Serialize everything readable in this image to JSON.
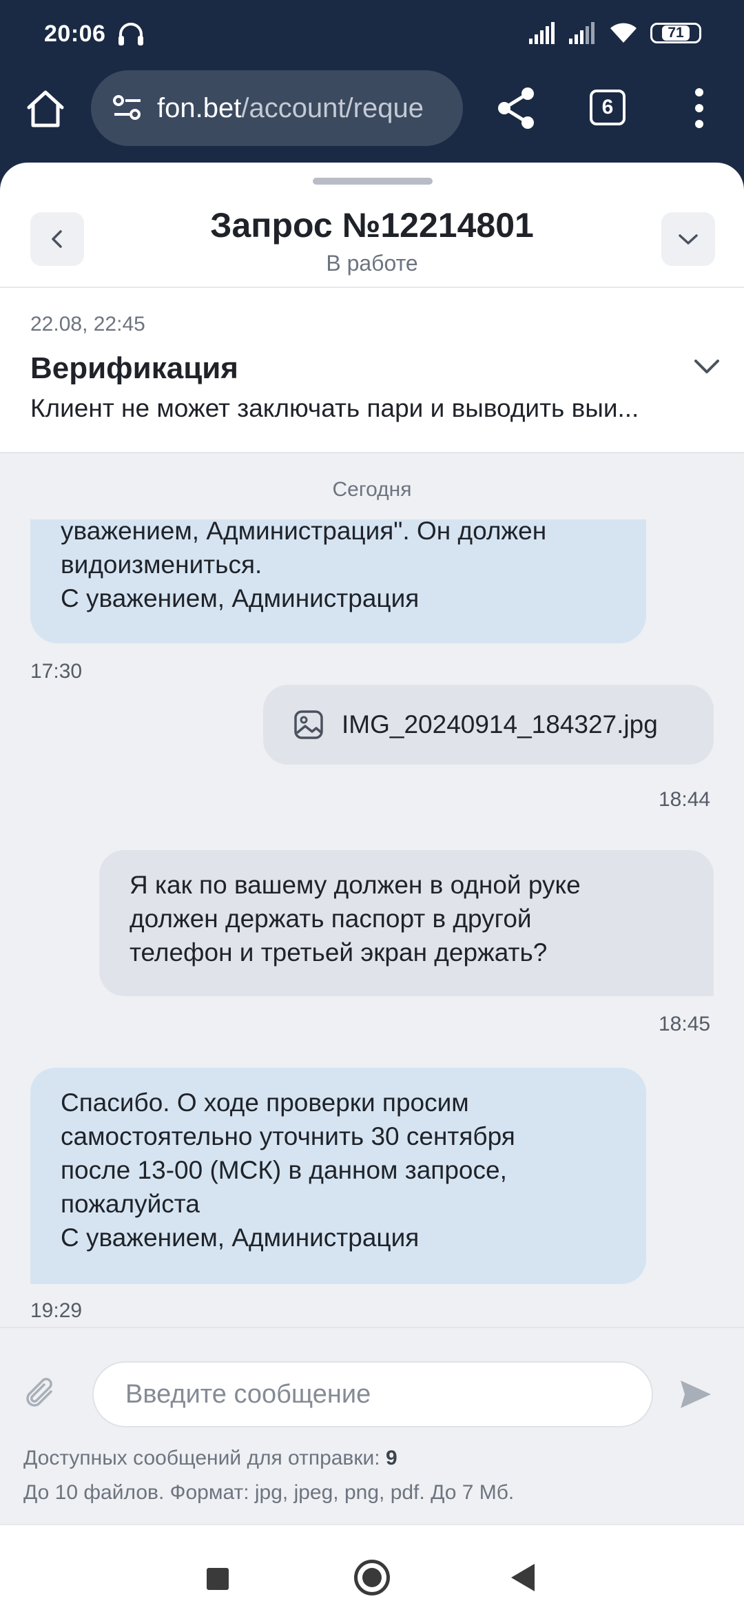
{
  "status_bar": {
    "time": "20:06",
    "battery": "71"
  },
  "browser": {
    "url_domain": "fon.bet",
    "url_path": "/account/reque",
    "tabs_count": "6"
  },
  "header": {
    "title": "Запрос №12214801",
    "status": "В работе"
  },
  "request": {
    "date": "22.08, 22:45",
    "topic": "Верификация",
    "description": "Клиент не может заключать пари и выводить выи..."
  },
  "chat": {
    "day_label": "Сегодня",
    "messages": [
      {
        "lines": [
          "уважением, Администрация\". Он должен",
          "видоизмениться.",
          "С уважением, Администрация"
        ],
        "time": "17:30"
      },
      {
        "file": "IMG_20240914_184327.jpg",
        "time": "18:44"
      },
      {
        "lines": [
          "Я как по вашему должен в одной руке",
          "должен держать паспорт в другой",
          "телефон и третьей экран держать?"
        ],
        "time": "18:45"
      },
      {
        "lines": [
          "Спасибо. О ходе проверки просим",
          "самостоятельно уточнить 30 сентября",
          "после 13-00 (МСК) в данном запросе,",
          "пожалуйста",
          "С уважением, Администрация"
        ],
        "time": "19:29"
      }
    ]
  },
  "composer": {
    "placeholder": "Введите сообщение",
    "limit_label": "Доступных сообщений для отправки: ",
    "limit_value": "9",
    "formats_note": "До 10 файлов. Формат: jpg, jpeg, png, pdf. До 7 Мб."
  },
  "icons": {
    "headphones": "headphones-icon",
    "home": "home-icon",
    "site_settings": "tune-icon",
    "share": "share-icon",
    "menu": "more-vertical-icon",
    "back": "chevron-left-icon",
    "collapse": "chevron-down-icon",
    "image_file": "image-icon",
    "attach": "paperclip-icon",
    "send": "send-icon"
  },
  "colors": {
    "browser_bg": "#1b2a44",
    "incoming_bubble": "#d6e4f2",
    "outgoing_bubble": "#e0e4ea",
    "chat_bg": "#eef0f3"
  }
}
